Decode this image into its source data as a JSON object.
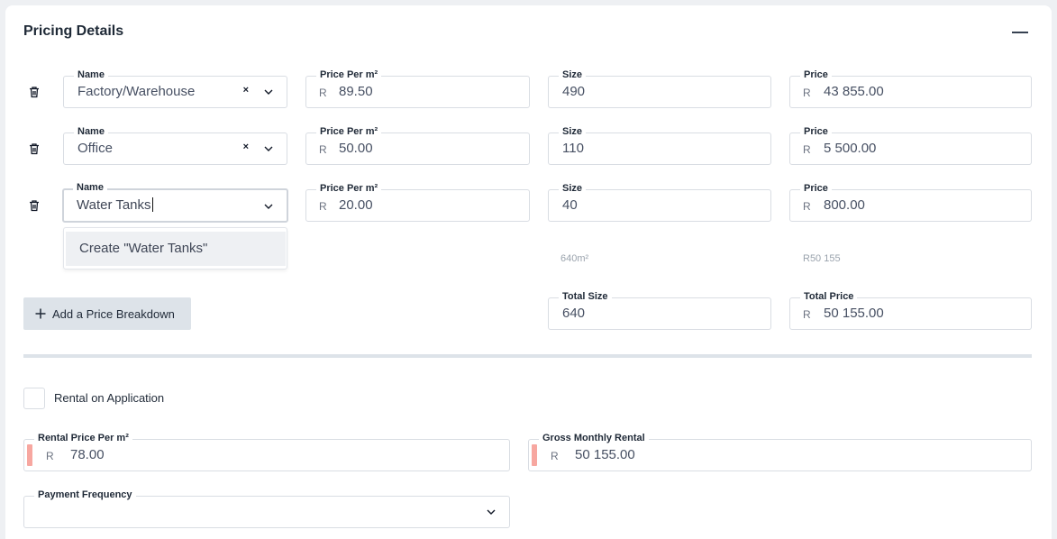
{
  "section": {
    "title": "Pricing Details"
  },
  "rows": [
    {
      "name_label": "Name",
      "name_value": "Factory/Warehouse",
      "clear": "×",
      "price_per_label": "Price Per m²",
      "price_per_prefix": "R",
      "price_per_value": "89.50",
      "size_label": "Size",
      "size_value": "490",
      "price_label": "Price",
      "price_prefix": "R",
      "price_value": "43 855.00"
    },
    {
      "name_label": "Name",
      "name_value": "Office",
      "clear": "×",
      "price_per_label": "Price Per m²",
      "price_per_prefix": "R",
      "price_per_value": "50.00",
      "size_label": "Size",
      "size_value": "110",
      "price_label": "Price",
      "price_prefix": "R",
      "price_value": "5 500.00"
    },
    {
      "name_label": "Name",
      "name_value": "Water Tanks",
      "price_per_label": "Price Per m²",
      "price_per_prefix": "R",
      "price_per_value": "20.00",
      "size_label": "Size",
      "size_value": "40",
      "price_label": "Price",
      "price_prefix": "R",
      "price_value": "800.00"
    }
  ],
  "dropdown": {
    "option": "Create \"Water Tanks\""
  },
  "hints": {
    "size": "640m²",
    "price": "R50 155"
  },
  "add_button": {
    "label": "Add a Price Breakdown"
  },
  "totals": {
    "size_label": "Total Size",
    "size_value": "640",
    "price_label": "Total Price",
    "price_prefix": "R",
    "price_value": "50 155.00"
  },
  "rental_on_application": {
    "label": "Rental on Application",
    "checked": false
  },
  "rental_price": {
    "label": "Rental Price Per m²",
    "prefix": "R",
    "value": "78.00"
  },
  "gross_monthly": {
    "label": "Gross Monthly Rental",
    "prefix": "R",
    "value": "50 155.00"
  },
  "payment_frequency": {
    "label": "Payment Frequency",
    "value": ""
  },
  "icons": {
    "trash": "trash-icon",
    "chevron": "chevron-down-icon",
    "plus": "plus-icon",
    "collapse": "minus-icon"
  },
  "colors": {
    "required_marker": "#f7a7a0",
    "button_bg": "#dde3e9",
    "divider": "#dde3e9"
  }
}
